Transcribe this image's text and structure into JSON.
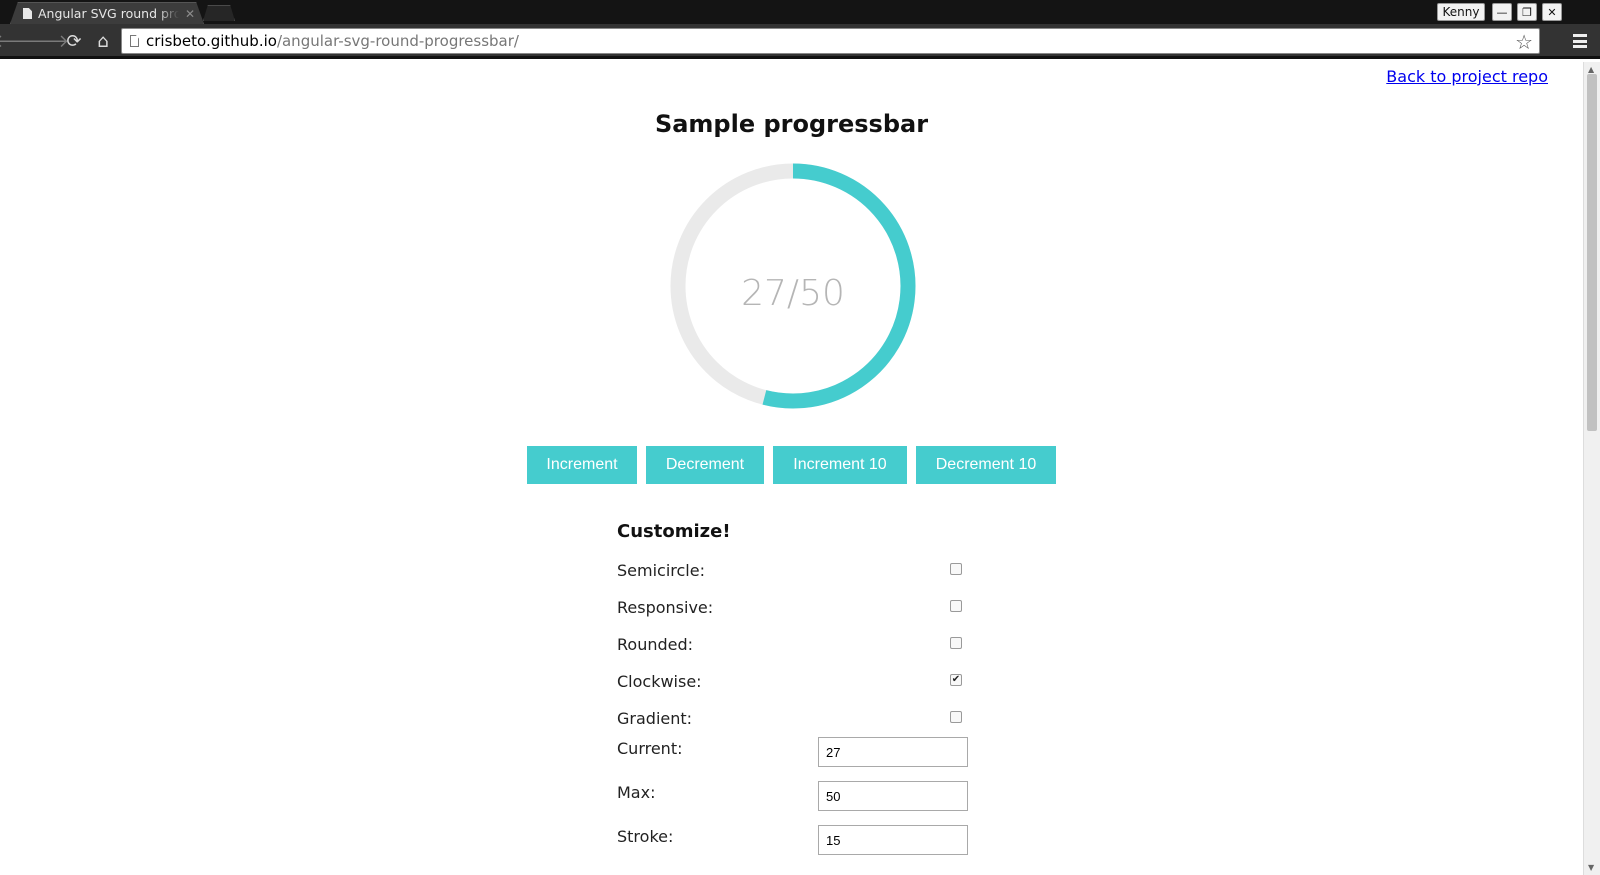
{
  "browser": {
    "tab_title": "Angular SVG round progressbar",
    "profile_name": "Kenny",
    "url_host": "crisbeto.github.io",
    "url_path": "/angular-svg-round-progressbar/",
    "window_controls": {
      "minimize": "—",
      "restore": "❐",
      "close": "✕"
    }
  },
  "page": {
    "back_link": "Back to project repo",
    "title": "Sample progressbar",
    "progress": {
      "current": 27,
      "max": 50,
      "label": "27/50",
      "fill_color": "#45ccce",
      "track_color": "#eaeaea"
    },
    "buttons": {
      "increment": "Increment",
      "decrement": "Decrement",
      "increment10": "Increment 10",
      "decrement10": "Decrement 10"
    },
    "customize": {
      "title": "Customize!",
      "options": [
        {
          "label": "Semicircle:",
          "checked": false
        },
        {
          "label": "Responsive:",
          "checked": false
        },
        {
          "label": "Rounded:",
          "checked": false
        },
        {
          "label": "Clockwise:",
          "checked": true
        },
        {
          "label": "Gradient:",
          "checked": false
        }
      ],
      "fields": [
        {
          "label": "Current:",
          "value": "27"
        },
        {
          "label": "Max:",
          "value": "50"
        },
        {
          "label": "Stroke:",
          "value": "15"
        }
      ]
    }
  },
  "colors": {
    "accent": "#45ccce",
    "link": "#0000ee"
  }
}
